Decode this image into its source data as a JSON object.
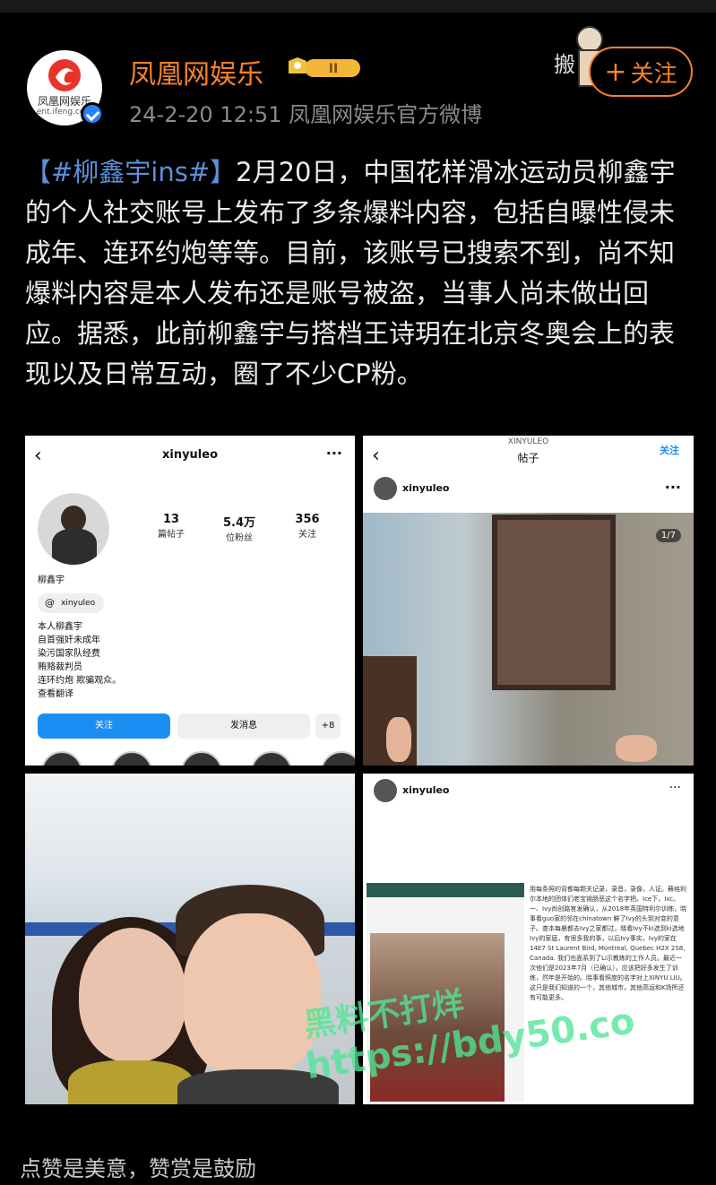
{
  "post": {
    "account_name": "凤凰网娱乐",
    "badge_level": "II",
    "meta": "24-2-20 12:51  凤凰网娱乐官方微博",
    "avatar_text": "凤凰网娱乐",
    "avatar_sub": "ent.ifeng.com",
    "sticker_text": "搬",
    "follow_label": "关注",
    "follow_plus": "+",
    "hashtag": "【#柳鑫宇ins#】",
    "body": "2月20日，中国花样滑冰运动员柳鑫宇的个人社交账号上发布了多条爆料内容，包括自曝性侵未成年、连环约炮等等。目前，该账号已搜索不到，尚不知爆料内容是本人发布还是账号被盗，当事人尚未做出回应。据悉，此前柳鑫宇与搭档王诗玥在北京冬奥会上的表现以及日常互动，圈了不少CP粉。"
  },
  "tile1": {
    "back": "‹",
    "username": "xinyuleo",
    "more": "···",
    "stats": [
      {
        "num": "13",
        "label": "篇帖子"
      },
      {
        "num": "5.4万",
        "label": "位粉丝"
      },
      {
        "num": "356",
        "label": "关注"
      }
    ],
    "display_name": "柳鑫宇",
    "threads_icon": "@",
    "threads_handle": "xinyuleo",
    "bio": [
      "本人柳鑫宇",
      "自首强奸未成年",
      "染污国家队经费",
      "贿赂裁判员",
      "连环约炮 欺骗观众。",
      "查看翻译"
    ],
    "follow_btn": "关注",
    "message_btn": "发消息",
    "add_user_btn": "+8"
  },
  "tile2": {
    "sub": "XINYULEO",
    "title": "帖子",
    "back": "‹",
    "follow": "关注",
    "username": "xinyuleo",
    "more": "···",
    "pager": "1/7"
  },
  "tile4": {
    "username": "xinyuleo",
    "more": "···",
    "text": "用每条照的背都每颗关记录，录音，录像，人证。蘇格利尔本地的团体们老宝锡肠恶这个名字把。Ice下，Ixc。一、Ivy尚创路官发确认，从2018年英国特利尔训练，晓事看guo家的邻在chinatown 鮮了Ivy的头到对变的意子。查本每晨都去Ivy之家都过，晓看Ivy不ki选到ki选地 Ivy的家庭，有很多我的事，以后Ivy事实，Ivy的家在14E7 St Laurent Bird, Montreal, Quebec H2X 2S8, Canada. 我们也面系到了Li示教练的工作人员。最近一次他们是2023年7月（已确认），应该把好多发生了训练，然年是开始的。晓事看照度的名字对上XINYU LIU。这只是我们知道的一个，其他城市，其他高运和K场所还有可能更多。"
  },
  "watermark": {
    "line1": "黑料不打烊",
    "line2": "https://bdy50.co"
  },
  "footer": {
    "text": "点赞是美意，赞赏是鼓励"
  },
  "colors": {
    "accent": "#f5822a",
    "hashtag": "#5b90d8",
    "verified": "#2a7ff5",
    "ig_blue": "#1a8ef2"
  }
}
